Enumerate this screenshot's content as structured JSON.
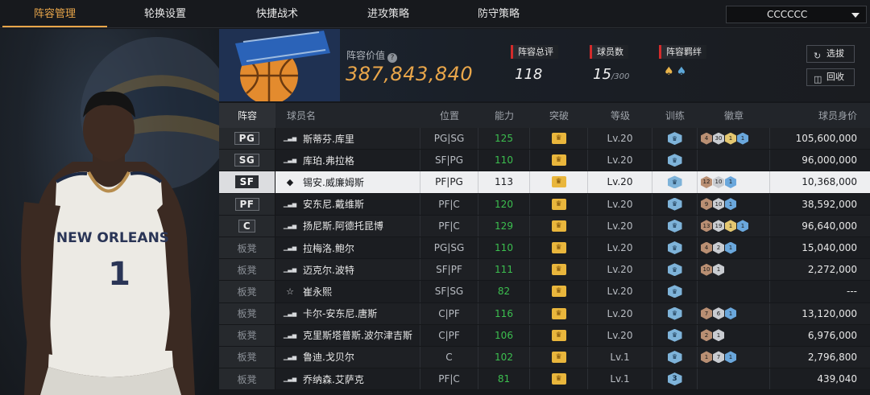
{
  "tabs": [
    {
      "label": "阵容管理",
      "active": true
    },
    {
      "label": "轮换设置",
      "active": false
    },
    {
      "label": "快捷战术",
      "active": false
    },
    {
      "label": "进攻策略",
      "active": false
    },
    {
      "label": "防守策略",
      "active": false
    }
  ],
  "team_select": {
    "value": "CCCCCC"
  },
  "header": {
    "value_label": "阵容价值",
    "help_icon": "?",
    "value": "387,843,840",
    "stats": [
      {
        "label": "阵容总评",
        "value": "118",
        "sub": ""
      },
      {
        "label": "球员数",
        "value": "15",
        "sub": "/300"
      },
      {
        "label": "阵容羁绊",
        "value": "",
        "sub": ""
      }
    ],
    "buttons": {
      "pick": "选拔",
      "recycle": "回收"
    }
  },
  "columns": [
    "阵容",
    "球员名",
    "位置",
    "能力",
    "突破",
    "等级",
    "训练",
    "徽章",
    "球员身价"
  ],
  "players": [
    {
      "slot": "PG",
      "starter": true,
      "icon": "bars",
      "name": "斯蒂芬.库里",
      "positions": "PG|SG",
      "ability": "125",
      "green": true,
      "level": "Lv.20",
      "train": "",
      "badges": [
        [
          "bronze",
          "4"
        ],
        [
          "silver",
          "30"
        ],
        [
          "gold",
          "1"
        ],
        [
          "blue",
          "1"
        ]
      ],
      "price": "105,600,000"
    },
    {
      "slot": "SG",
      "starter": true,
      "icon": "bars",
      "name": "库珀.弗拉格",
      "positions": "SF|PG",
      "ability": "110",
      "green": true,
      "level": "Lv.20",
      "train": "",
      "badges": [],
      "price": "96,000,000"
    },
    {
      "slot": "SF",
      "starter": true,
      "icon": "diamond",
      "name": "锡安.威廉姆斯",
      "positions": "PF|PG",
      "ability": "113",
      "green": false,
      "level": "Lv.20",
      "train": "",
      "badges": [
        [
          "bronze",
          "12"
        ],
        [
          "silver",
          "10"
        ],
        [
          "blue",
          "1"
        ]
      ],
      "price": "10,368,000",
      "selected": true
    },
    {
      "slot": "PF",
      "starter": true,
      "icon": "bars",
      "name": "安东尼.戴维斯",
      "positions": "PF|C",
      "ability": "120",
      "green": true,
      "level": "Lv.20",
      "train": "",
      "badges": [
        [
          "bronze",
          "9"
        ],
        [
          "silver",
          "10"
        ],
        [
          "blue",
          "1"
        ]
      ],
      "price": "38,592,000"
    },
    {
      "slot": "C",
      "starter": true,
      "icon": "bars",
      "name": "扬尼斯.阿德托昆博",
      "positions": "PF|C",
      "ability": "129",
      "green": true,
      "level": "Lv.20",
      "train": "",
      "badges": [
        [
          "bronze",
          "13"
        ],
        [
          "silver",
          "19"
        ],
        [
          "gold",
          "1"
        ],
        [
          "blue",
          "1"
        ]
      ],
      "price": "96,640,000"
    },
    {
      "slot": "板凳",
      "starter": false,
      "icon": "bars",
      "name": "拉梅洛.鲍尔",
      "positions": "PG|SG",
      "ability": "110",
      "green": true,
      "level": "Lv.20",
      "train": "",
      "badges": [
        [
          "bronze",
          "4"
        ],
        [
          "silver",
          "2"
        ],
        [
          "blue",
          "1"
        ]
      ],
      "price": "15,040,000"
    },
    {
      "slot": "板凳",
      "starter": false,
      "icon": "bars",
      "name": "迈克尔.波特",
      "positions": "SF|PF",
      "ability": "111",
      "green": true,
      "level": "Lv.20",
      "train": "",
      "badges": [
        [
          "bronze",
          "10"
        ],
        [
          "silver",
          "1"
        ]
      ],
      "price": "2,272,000"
    },
    {
      "slot": "板凳",
      "starter": false,
      "icon": "star",
      "name": "崔永熙",
      "positions": "SF|SG",
      "ability": "82",
      "green": true,
      "level": "Lv.20",
      "train": "",
      "badges": [],
      "price": "---"
    },
    {
      "slot": "板凳",
      "starter": false,
      "icon": "bars",
      "name": "卡尔-安东尼.唐斯",
      "positions": "C|PF",
      "ability": "116",
      "green": true,
      "level": "Lv.20",
      "train": "",
      "badges": [
        [
          "bronze",
          "7"
        ],
        [
          "silver",
          "6"
        ],
        [
          "blue",
          "1"
        ]
      ],
      "price": "13,120,000"
    },
    {
      "slot": "板凳",
      "starter": false,
      "icon": "bars",
      "name": "克里斯塔普斯.波尔津吉斯",
      "positions": "C|PF",
      "ability": "106",
      "green": true,
      "level": "Lv.20",
      "train": "",
      "badges": [
        [
          "bronze",
          "2"
        ],
        [
          "silver",
          "1"
        ]
      ],
      "price": "6,976,000"
    },
    {
      "slot": "板凳",
      "starter": false,
      "icon": "bars",
      "name": "鲁迪.戈贝尔",
      "positions": "C",
      "ability": "102",
      "green": true,
      "level": "Lv.1",
      "train": "",
      "badges": [
        [
          "bronze",
          "1"
        ],
        [
          "silver",
          "7"
        ],
        [
          "blue",
          "1"
        ]
      ],
      "price": "2,796,800"
    },
    {
      "slot": "板凳",
      "starter": false,
      "icon": "bars",
      "name": "乔纳森.艾萨克",
      "positions": "PF|C",
      "ability": "81",
      "green": true,
      "level": "Lv.1",
      "train": "3",
      "badges": [],
      "price": "439,040"
    }
  ],
  "colors": {
    "accent": "#e9a64a",
    "green": "#3cbf4f",
    "red_marker": "#d32b2b"
  }
}
